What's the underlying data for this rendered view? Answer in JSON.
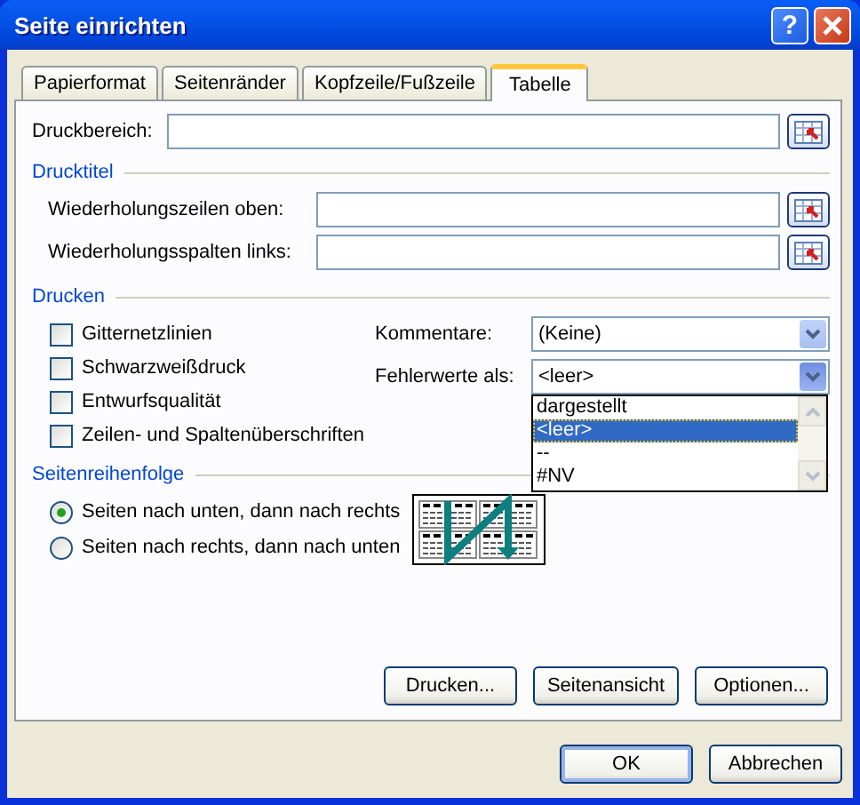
{
  "window": {
    "title": "Seite einrichten",
    "help": "?"
  },
  "tabs": [
    {
      "label": "Papierformat",
      "selected": false
    },
    {
      "label": "Seitenränder",
      "selected": false
    },
    {
      "label": "Kopfzeile/Fußzeile",
      "selected": false
    },
    {
      "label": "Tabelle",
      "selected": true
    }
  ],
  "print_area": {
    "label": "Druckbereich:"
  },
  "print_titles": {
    "heading": "Drucktitel",
    "fields": [
      {
        "label": "Wiederholungszeilen oben:"
      },
      {
        "label": "Wiederholungsspalten links:"
      }
    ]
  },
  "print": {
    "heading": "Drucken",
    "checkboxes": [
      {
        "label": "Gitternetzlinien",
        "checked": false
      },
      {
        "label": "Schwarzweißdruck",
        "checked": false
      },
      {
        "label": "Entwurfsqualität",
        "checked": false
      },
      {
        "label": "Zeilen- und Spaltenüberschriften",
        "checked": false
      }
    ],
    "comments": {
      "label": "Kommentare:",
      "value": "(Keine)"
    },
    "errors": {
      "label": "Fehlerwerte als:",
      "value": "<leer>",
      "expanded": true,
      "options": [
        {
          "label": "dargestellt",
          "selected": false
        },
        {
          "label": "<leer>",
          "selected": true
        },
        {
          "label": "--",
          "selected": false
        },
        {
          "label": "#NV",
          "selected": false
        }
      ]
    }
  },
  "page_order": {
    "heading": "Seitenreihenfolge",
    "radios": [
      {
        "label": "Seiten nach unten, dann nach rechts",
        "selected": true
      },
      {
        "label": "Seiten nach rechts, dann nach unten",
        "selected": false
      }
    ]
  },
  "panel_buttons": [
    "Drucken...",
    "Seitenansicht",
    "Optionen..."
  ],
  "buttons": [
    "OK",
    "Abbrechen"
  ]
}
